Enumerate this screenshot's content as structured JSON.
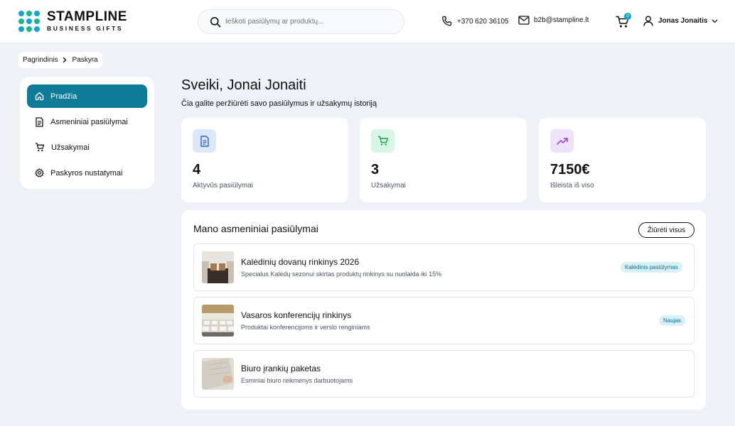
{
  "header": {
    "logo_main": "STAMPLINE",
    "logo_sub": "BUSINESS GIFTS",
    "search_placeholder": "Ieškoti pasiūlymų ar produktų...",
    "phone": "+370 620 36105",
    "email": "b2b@stampline.lt",
    "cart_count": "0",
    "user_name": "Jonas Jonaitis"
  },
  "breadcrumb": [
    "Pagrindinis",
    "Paskyra"
  ],
  "sidebar": {
    "items": [
      {
        "label": "Pradžia",
        "icon": "home-icon",
        "active": true
      },
      {
        "label": "Asmeniniai pasiūlymai",
        "icon": "document-icon",
        "active": false
      },
      {
        "label": "Užsakymai",
        "icon": "cart-icon",
        "active": false
      },
      {
        "label": "Paskyros nustatymai",
        "icon": "gear-icon",
        "active": false
      }
    ]
  },
  "main": {
    "welcome": "Sveiki, Jonai Jonaiti",
    "subtitle": "Čia galite peržiūrėti savo pasiūlymus ir užsakymų istoriją",
    "stats": [
      {
        "value": "4",
        "label": "Aktyvūs pasiūlymai",
        "icon": "document-icon",
        "icon_bg": "#dbe7fb",
        "icon_color": "#2f5fd0"
      },
      {
        "value": "3",
        "label": "Užsakymai",
        "icon": "cart-icon",
        "icon_bg": "#d9f5e3",
        "icon_color": "#16a34a"
      },
      {
        "value": "7150€",
        "label": "Išleista iš viso",
        "icon": "trend-up-icon",
        "icon_bg": "#efe2fb",
        "icon_color": "#9333ea"
      }
    ],
    "offers_title": "Mano asmeniniai pasiūlymai",
    "view_all": "Žiūrėti visus",
    "offers": [
      {
        "title": "Kalėdinių dovanų rinkinys 2026",
        "description": "Specialus Kalėdų sezonui skirtas produktų rinkinys su nuolaida iki 15%",
        "badge": "Kalėdinis pasiūlymas"
      },
      {
        "title": "Vasaros konferencijų rinkinys",
        "description": "Produktai konferencijoms ir verslo renginiams",
        "badge": "Naujas"
      },
      {
        "title": "Biuro įrankių paketas",
        "description": "Esminiai biuro reikmenys darbuotojams",
        "badge": ""
      }
    ]
  },
  "colors": {
    "accent": "#0e7c99",
    "badge_bg": "#d8f0f7",
    "page_bg": "#eef2f7"
  }
}
